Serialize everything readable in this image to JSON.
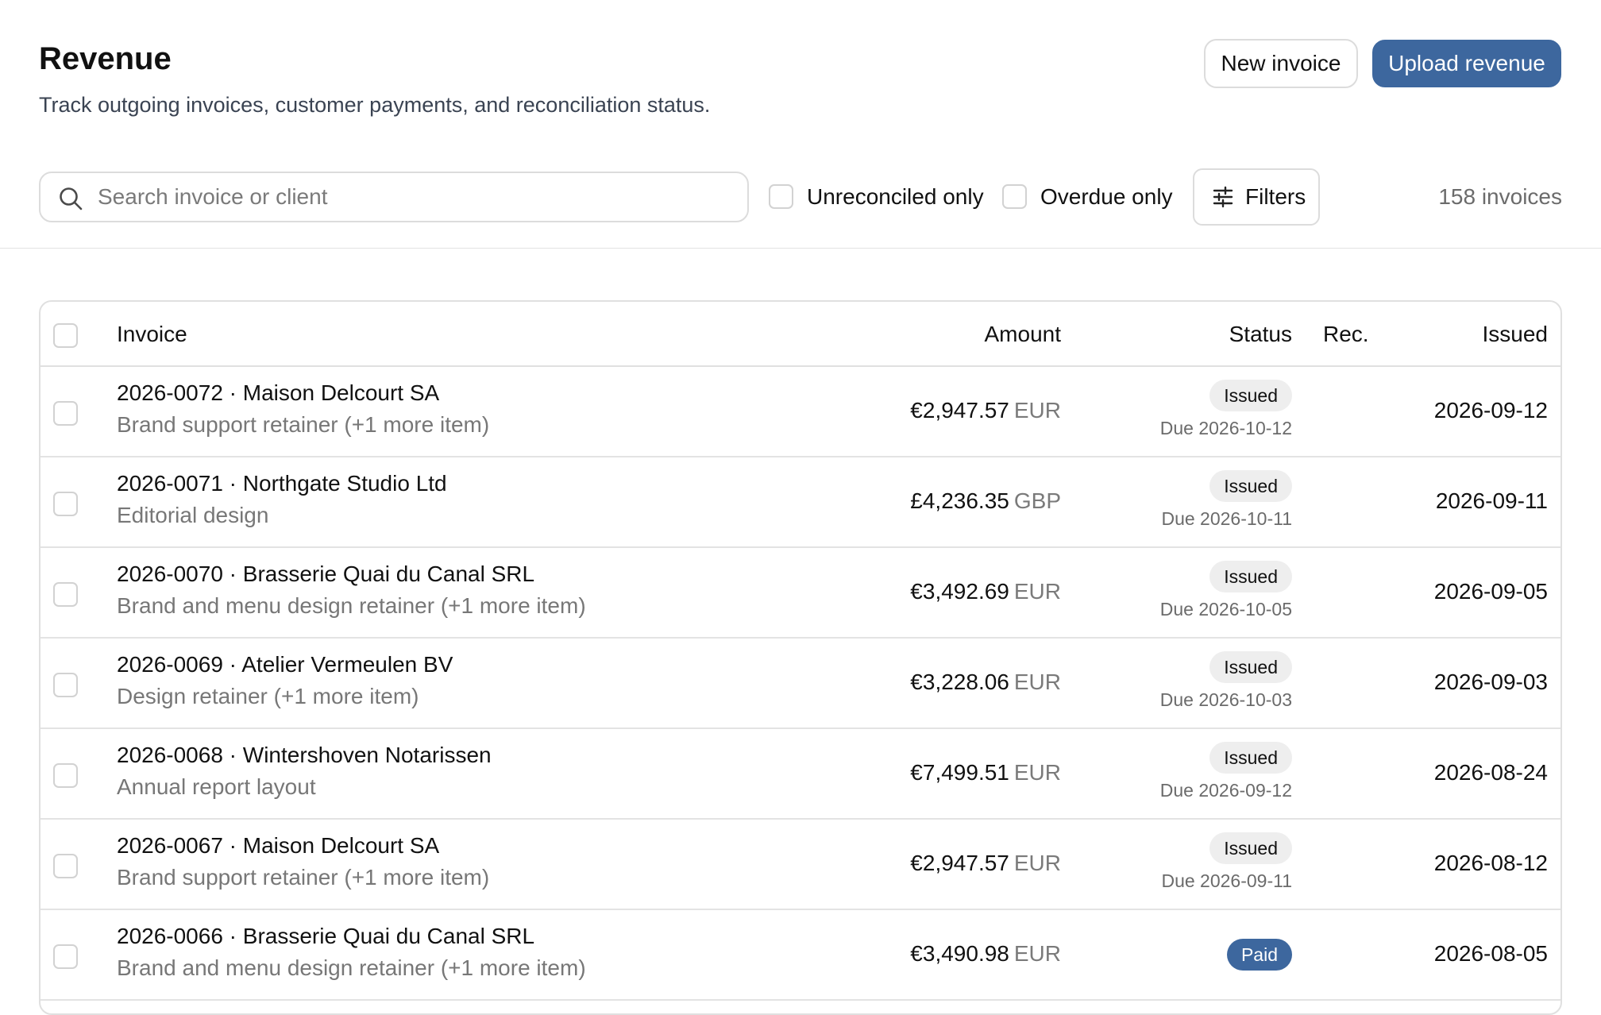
{
  "header": {
    "title": "Revenue",
    "subtitle": "Track outgoing invoices, customer payments, and reconciliation status.",
    "new_invoice_label": "New invoice",
    "upload_label": "Upload revenue"
  },
  "toolbar": {
    "search_placeholder": "Search invoice or client",
    "search_value": "",
    "unreconciled_label": "Unreconciled only",
    "unreconciled_checked": false,
    "overdue_label": "Overdue only",
    "overdue_checked": false,
    "filters_label": "Filters",
    "count_label": "158 invoices"
  },
  "table": {
    "columns": {
      "invoice": "Invoice",
      "amount": "Amount",
      "status": "Status",
      "rec": "Rec.",
      "issued": "Issued"
    },
    "rows": [
      {
        "title": "2026-0072 · Maison Delcourt SA",
        "desc": "Brand support retainer (+1 more item)",
        "amount": "€2,947.57",
        "currency": "EUR",
        "status": "Issued",
        "due": "Due 2026-10-12",
        "issued": "2026-09-12"
      },
      {
        "title": "2026-0071 · Northgate Studio Ltd",
        "desc": "Editorial design",
        "amount": "£4,236.35",
        "currency": "GBP",
        "status": "Issued",
        "due": "Due 2026-10-11",
        "issued": "2026-09-11"
      },
      {
        "title": "2026-0070 · Brasserie Quai du Canal SRL",
        "desc": "Brand and menu design retainer (+1 more item)",
        "amount": "€3,492.69",
        "currency": "EUR",
        "status": "Issued",
        "due": "Due 2026-10-05",
        "issued": "2026-09-05"
      },
      {
        "title": "2026-0069 · Atelier Vermeulen BV",
        "desc": "Design retainer (+1 more item)",
        "amount": "€3,228.06",
        "currency": "EUR",
        "status": "Issued",
        "due": "Due 2026-10-03",
        "issued": "2026-09-03"
      },
      {
        "title": "2026-0068 · Wintershoven Notarissen",
        "desc": "Annual report layout",
        "amount": "€7,499.51",
        "currency": "EUR",
        "status": "Issued",
        "due": "Due 2026-09-12",
        "issued": "2026-08-24"
      },
      {
        "title": "2026-0067 · Maison Delcourt SA",
        "desc": "Brand support retainer (+1 more item)",
        "amount": "€2,947.57",
        "currency": "EUR",
        "status": "Issued",
        "due": "Due 2026-09-11",
        "issued": "2026-08-12"
      },
      {
        "title": "2026-0066 · Brasserie Quai du Canal SRL",
        "desc": "Brand and menu design retainer (+1 more item)",
        "amount": "€3,490.98",
        "currency": "EUR",
        "status": "Paid",
        "due": "",
        "issued": "2026-08-05"
      }
    ]
  },
  "colors": {
    "primary": "#3d679e",
    "border": "#e0e0e0",
    "muted_text": "#777777",
    "badge_issued_bg": "#eeeeee"
  },
  "icons": {
    "search": "search-icon",
    "filters": "sliders-icon"
  }
}
